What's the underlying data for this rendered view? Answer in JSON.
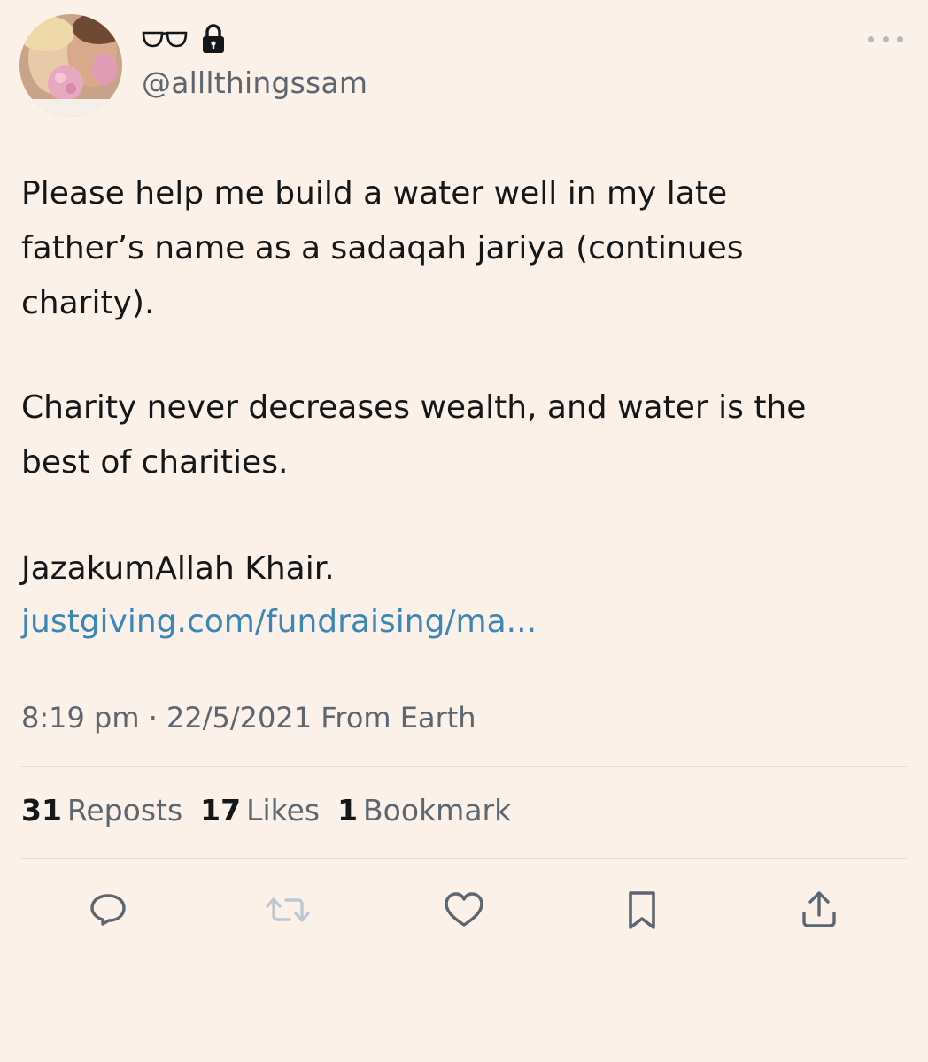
{
  "user": {
    "handle": "@alllthingssam",
    "name_icons": [
      "sunglasses-icon",
      "lock-icon"
    ],
    "avatar": "avatar-photo"
  },
  "tweet": {
    "line1": "Please help me build a water well in my late",
    "line2": "father’s name as a sadaqah jariya (continues",
    "line3": "charity).",
    "line4": "Charity never decreases wealth, and water is the",
    "line5": "best of charities.",
    "line6": "JazakumAllah Khair.",
    "link": "justgiving.com/fundraising/ma..."
  },
  "meta": {
    "time": "8:19 pm",
    "separator": " · ",
    "date": "22/5/2021",
    "location": "From Earth"
  },
  "stats": {
    "reposts_count": "31",
    "reposts_label": "Reposts",
    "likes_count": "17",
    "likes_label": "Likes",
    "bookmarks_count": "1",
    "bookmarks_label": "Bookmark"
  },
  "actions": [
    "reply-icon",
    "repost-icon",
    "like-icon",
    "bookmark-icon",
    "share-icon"
  ],
  "colors": {
    "background": "#fbf1e8",
    "text": "#14171a",
    "secondary": "#5b6670",
    "link": "#3a86b8",
    "repost_disabled": "#bfc8cf"
  }
}
